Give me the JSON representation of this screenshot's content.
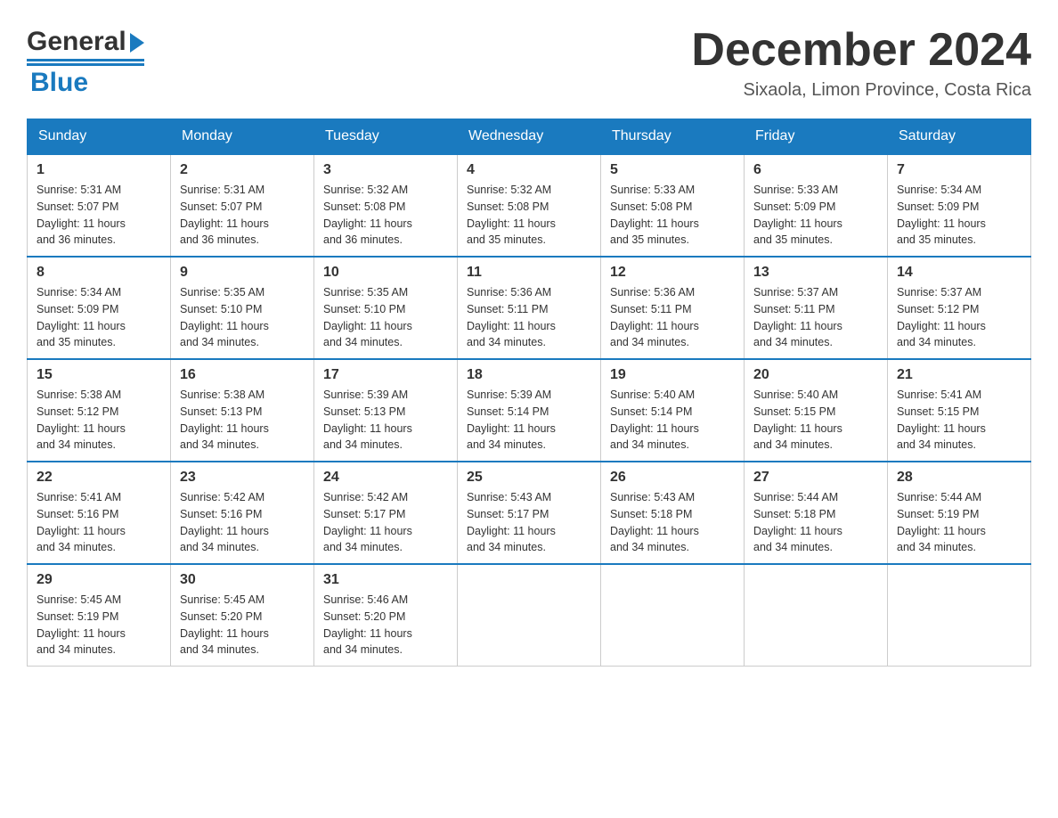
{
  "header": {
    "logo_general": "General",
    "logo_arrow": "▶",
    "logo_blue": "Blue",
    "month_title": "December 2024",
    "location": "Sixaola, Limon Province, Costa Rica"
  },
  "calendar": {
    "days_of_week": [
      "Sunday",
      "Monday",
      "Tuesday",
      "Wednesday",
      "Thursday",
      "Friday",
      "Saturday"
    ],
    "weeks": [
      [
        {
          "day": "1",
          "sunrise": "5:31 AM",
          "sunset": "5:07 PM",
          "daylight": "11 hours and 36 minutes."
        },
        {
          "day": "2",
          "sunrise": "5:31 AM",
          "sunset": "5:07 PM",
          "daylight": "11 hours and 36 minutes."
        },
        {
          "day": "3",
          "sunrise": "5:32 AM",
          "sunset": "5:08 PM",
          "daylight": "11 hours and 36 minutes."
        },
        {
          "day": "4",
          "sunrise": "5:32 AM",
          "sunset": "5:08 PM",
          "daylight": "11 hours and 35 minutes."
        },
        {
          "day": "5",
          "sunrise": "5:33 AM",
          "sunset": "5:08 PM",
          "daylight": "11 hours and 35 minutes."
        },
        {
          "day": "6",
          "sunrise": "5:33 AM",
          "sunset": "5:09 PM",
          "daylight": "11 hours and 35 minutes."
        },
        {
          "day": "7",
          "sunrise": "5:34 AM",
          "sunset": "5:09 PM",
          "daylight": "11 hours and 35 minutes."
        }
      ],
      [
        {
          "day": "8",
          "sunrise": "5:34 AM",
          "sunset": "5:09 PM",
          "daylight": "11 hours and 35 minutes."
        },
        {
          "day": "9",
          "sunrise": "5:35 AM",
          "sunset": "5:10 PM",
          "daylight": "11 hours and 34 minutes."
        },
        {
          "day": "10",
          "sunrise": "5:35 AM",
          "sunset": "5:10 PM",
          "daylight": "11 hours and 34 minutes."
        },
        {
          "day": "11",
          "sunrise": "5:36 AM",
          "sunset": "5:11 PM",
          "daylight": "11 hours and 34 minutes."
        },
        {
          "day": "12",
          "sunrise": "5:36 AM",
          "sunset": "5:11 PM",
          "daylight": "11 hours and 34 minutes."
        },
        {
          "day": "13",
          "sunrise": "5:37 AM",
          "sunset": "5:11 PM",
          "daylight": "11 hours and 34 minutes."
        },
        {
          "day": "14",
          "sunrise": "5:37 AM",
          "sunset": "5:12 PM",
          "daylight": "11 hours and 34 minutes."
        }
      ],
      [
        {
          "day": "15",
          "sunrise": "5:38 AM",
          "sunset": "5:12 PM",
          "daylight": "11 hours and 34 minutes."
        },
        {
          "day": "16",
          "sunrise": "5:38 AM",
          "sunset": "5:13 PM",
          "daylight": "11 hours and 34 minutes."
        },
        {
          "day": "17",
          "sunrise": "5:39 AM",
          "sunset": "5:13 PM",
          "daylight": "11 hours and 34 minutes."
        },
        {
          "day": "18",
          "sunrise": "5:39 AM",
          "sunset": "5:14 PM",
          "daylight": "11 hours and 34 minutes."
        },
        {
          "day": "19",
          "sunrise": "5:40 AM",
          "sunset": "5:14 PM",
          "daylight": "11 hours and 34 minutes."
        },
        {
          "day": "20",
          "sunrise": "5:40 AM",
          "sunset": "5:15 PM",
          "daylight": "11 hours and 34 minutes."
        },
        {
          "day": "21",
          "sunrise": "5:41 AM",
          "sunset": "5:15 PM",
          "daylight": "11 hours and 34 minutes."
        }
      ],
      [
        {
          "day": "22",
          "sunrise": "5:41 AM",
          "sunset": "5:16 PM",
          "daylight": "11 hours and 34 minutes."
        },
        {
          "day": "23",
          "sunrise": "5:42 AM",
          "sunset": "5:16 PM",
          "daylight": "11 hours and 34 minutes."
        },
        {
          "day": "24",
          "sunrise": "5:42 AM",
          "sunset": "5:17 PM",
          "daylight": "11 hours and 34 minutes."
        },
        {
          "day": "25",
          "sunrise": "5:43 AM",
          "sunset": "5:17 PM",
          "daylight": "11 hours and 34 minutes."
        },
        {
          "day": "26",
          "sunrise": "5:43 AM",
          "sunset": "5:18 PM",
          "daylight": "11 hours and 34 minutes."
        },
        {
          "day": "27",
          "sunrise": "5:44 AM",
          "sunset": "5:18 PM",
          "daylight": "11 hours and 34 minutes."
        },
        {
          "day": "28",
          "sunrise": "5:44 AM",
          "sunset": "5:19 PM",
          "daylight": "11 hours and 34 minutes."
        }
      ],
      [
        {
          "day": "29",
          "sunrise": "5:45 AM",
          "sunset": "5:19 PM",
          "daylight": "11 hours and 34 minutes."
        },
        {
          "day": "30",
          "sunrise": "5:45 AM",
          "sunset": "5:20 PM",
          "daylight": "11 hours and 34 minutes."
        },
        {
          "day": "31",
          "sunrise": "5:46 AM",
          "sunset": "5:20 PM",
          "daylight": "11 hours and 34 minutes."
        },
        null,
        null,
        null,
        null
      ]
    ],
    "labels": {
      "sunrise": "Sunrise:",
      "sunset": "Sunset:",
      "daylight": "Daylight:"
    }
  }
}
